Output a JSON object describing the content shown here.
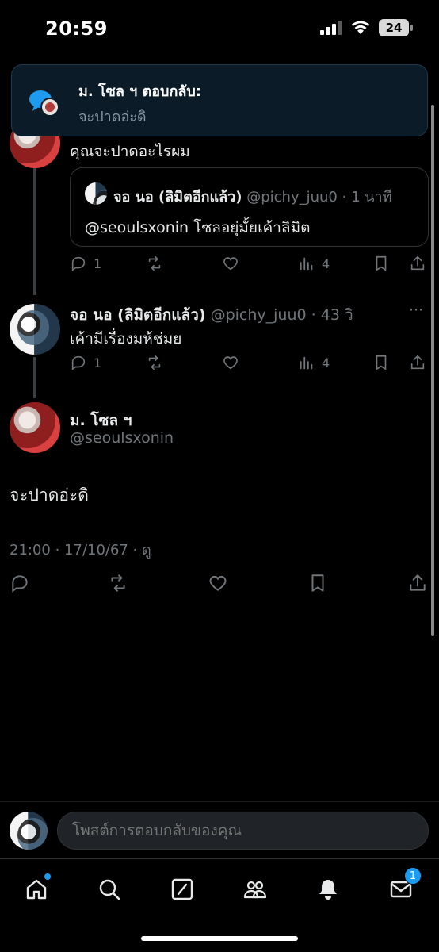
{
  "status_bar": {
    "time": "20:59",
    "battery": "24"
  },
  "toast": {
    "title": "ม. โซล ฯ ตอบกลับ:",
    "message": "จะปาดอ่ะดิ"
  },
  "post1": {
    "text": "คุณจะปาดอะไรผม",
    "quote": {
      "name": "จอ นอ (ลิมิตอีกแล้ว)",
      "handle": "@pichy_juu0",
      "time": "· 1 นาที",
      "text": "@seoulsxonin โซลอยุ่มั้ยเค้าลิมิต"
    },
    "replies": "1",
    "views": "4"
  },
  "post2": {
    "name": "จอ นอ (ลิมิตอีกแล้ว)",
    "handle": "@pichy_juu0",
    "time": "· 43 วิ",
    "text": "เค้ามีเรื่องมห้ช่มย",
    "replies": "1",
    "views": "4",
    "more": "···"
  },
  "main_post": {
    "name": "ม. โซล ฯ",
    "handle": "@seoulsxonin",
    "text": "จะปาดอ่ะดิ",
    "meta": "21:00 · 17/10/67 · ดู"
  },
  "reply_bar": {
    "placeholder": "โพสต์การตอบกลับของคุณ"
  },
  "tabbar": {
    "messages_badge": "1"
  },
  "colors": {
    "accent": "#1d9bf0",
    "muted": "#71767b",
    "text": "#e7e9ea",
    "border": "#2f3336"
  }
}
